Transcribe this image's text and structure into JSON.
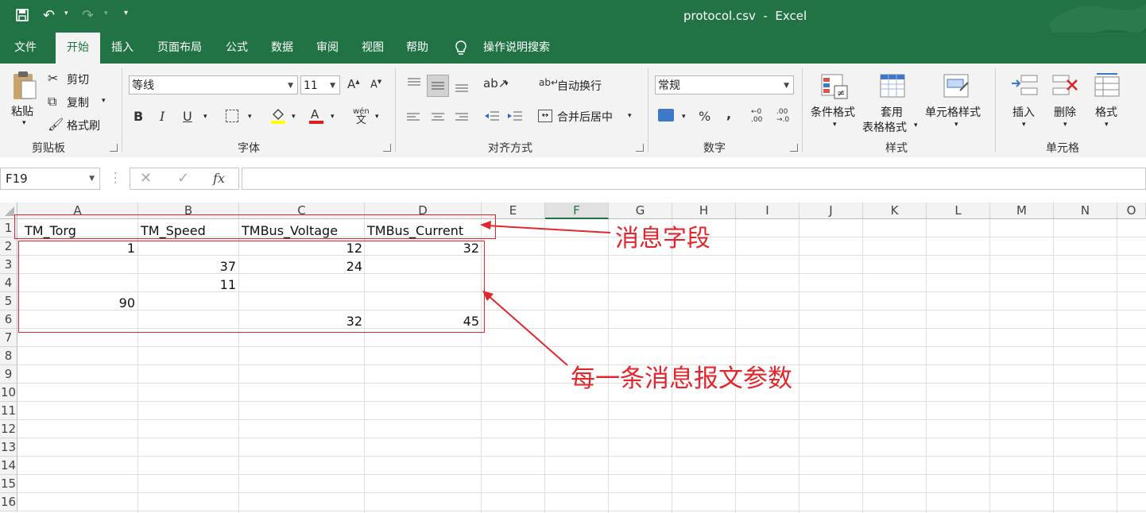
{
  "window": {
    "title": "protocol.csv  -  Excel"
  },
  "tabs": [
    "文件",
    "开始",
    "插入",
    "页面布局",
    "公式",
    "数据",
    "审阅",
    "视图",
    "帮助"
  ],
  "tell_me": "操作说明搜索",
  "clipboard": {
    "paste": "粘贴",
    "cut": "剪切",
    "copy": "复制",
    "format_painter": "格式刷",
    "group": "剪贴板"
  },
  "font": {
    "name": "等线",
    "size": "11",
    "group": "字体",
    "bold": "B",
    "italic": "I",
    "underline": "U"
  },
  "alignment": {
    "wrap": "自动换行",
    "merge": "合并后居中",
    "group": "对齐方式"
  },
  "number": {
    "format": "常规",
    "percent": "%",
    "comma": ",",
    "group": "数字"
  },
  "styles": {
    "conditional": "条件格式",
    "table_1": "套用",
    "table_2": "表格格式",
    "cell_styles": "单元格样式",
    "group": "样式"
  },
  "cells": {
    "insert": "插入",
    "delete": "删除",
    "format": "格式",
    "group": "单元格"
  },
  "formula_bar": {
    "name_box": "F19",
    "fx": "fx",
    "value": ""
  },
  "sheet": {
    "columns": [
      "A",
      "B",
      "C",
      "D",
      "E",
      "F",
      "G",
      "H",
      "I",
      "J",
      "K",
      "L",
      "M",
      "N",
      "O"
    ],
    "rows": [
      "1",
      "2",
      "3",
      "4",
      "5",
      "6",
      "7",
      "8",
      "9",
      "10",
      "11",
      "12",
      "13",
      "14",
      "15",
      "16"
    ],
    "cells": {
      "A1": "TM_Torg",
      "B1": "TM_Speed",
      "C1": "TMBus_Voltage",
      "D1": "TMBus_Current",
      "A2": "1",
      "C2": "12",
      "D2": "32",
      "B3": "37",
      "C3": "24",
      "B4": "11",
      "A5": "90",
      "C6": "32",
      "D6": "45"
    }
  },
  "annotations": {
    "fields": "消息字段",
    "params": "每一条消息报文参数"
  },
  "colors": {
    "excel_green": "#217346",
    "annotation_red": "#e3262b"
  }
}
